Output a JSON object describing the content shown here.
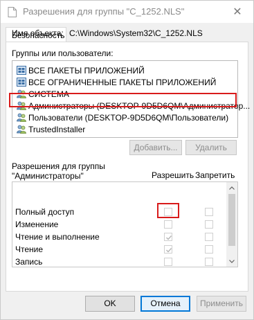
{
  "window": {
    "title": "Разрешения для группы \"C_1252.NLS\"",
    "close_glyph": "✕"
  },
  "tab": {
    "label": "Безопасность"
  },
  "object": {
    "label": "Имя объекта:",
    "value": "C:\\Windows\\System32\\C_1252.NLS"
  },
  "groups": {
    "label": "Группы или пользователи:",
    "items": [
      {
        "name": "ВСЕ ПАКЕТЫ ПРИЛОЖЕНИЙ",
        "icon": "package-icon"
      },
      {
        "name": "ВСЕ ОГРАНИЧЕННЫЕ ПАКЕТЫ ПРИЛОЖЕНИЙ",
        "icon": "package-icon"
      },
      {
        "name": "СИСТЕМА",
        "icon": "users-icon"
      },
      {
        "name": "Администраторы (DESKTOP-9D5D6QM\\Администратор...",
        "icon": "users-icon",
        "selected": true
      },
      {
        "name": "Пользователи (DESKTOP-9D5D6QM\\Пользователи)",
        "icon": "users-icon"
      },
      {
        "name": "TrustedInstaller",
        "icon": "users-icon"
      }
    ]
  },
  "buttons": {
    "add": "Добавить...",
    "remove": "Удалить",
    "ok": "OK",
    "cancel": "Отмена",
    "apply": "Применить"
  },
  "permissions": {
    "title_line1": "Разрешения для группы",
    "title_line2": "\"Администраторы\"",
    "allow_header": "Разрешить",
    "deny_header": "Запретить",
    "rows": [
      {
        "name": "Полный доступ",
        "allow": false,
        "deny": false
      },
      {
        "name": "Изменение",
        "allow": false,
        "deny": false
      },
      {
        "name": "Чтение и выполнение",
        "allow": true,
        "deny": false
      },
      {
        "name": "Чтение",
        "allow": true,
        "deny": false
      },
      {
        "name": "Запись",
        "allow": false,
        "deny": false
      },
      {
        "name": "",
        "allow": false,
        "deny": false
      }
    ]
  },
  "colors": {
    "highlight": "#d81b1b",
    "focus": "#0078d7"
  }
}
